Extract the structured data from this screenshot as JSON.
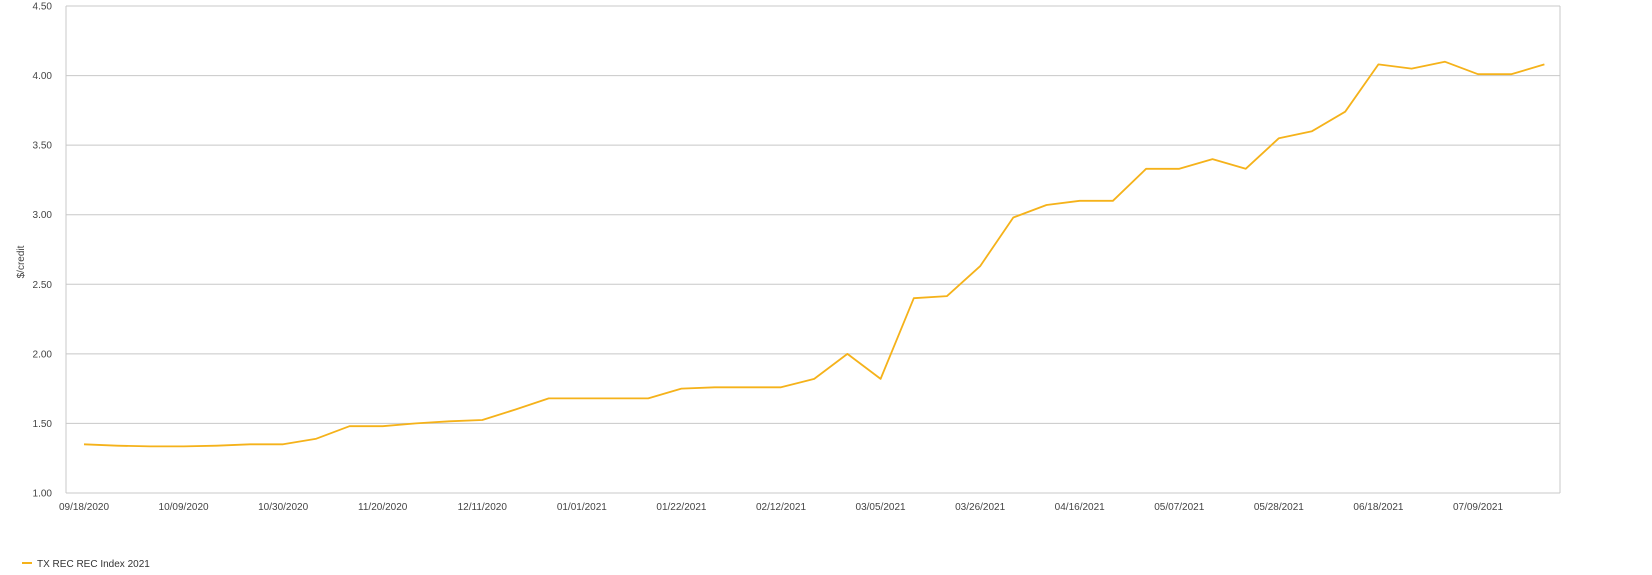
{
  "chart_data": {
    "type": "line",
    "title": "",
    "xlabel": "",
    "ylabel": "$/credit",
    "ylim": [
      1.0,
      4.5
    ],
    "yticks": [
      "1.00",
      "1.50",
      "2.00",
      "2.50",
      "3.00",
      "3.50",
      "4.00",
      "4.50"
    ],
    "xticks": [
      "09/18/2020",
      "10/09/2020",
      "10/30/2020",
      "11/20/2020",
      "12/11/2020",
      "01/01/2021",
      "01/22/2021",
      "02/12/2021",
      "03/05/2021",
      "03/26/2021",
      "04/16/2021",
      "05/07/2021",
      "05/28/2021",
      "06/18/2021",
      "07/09/2021"
    ],
    "grid": true,
    "legend_position": "bottom-left",
    "series": [
      {
        "name": "TX REC REC Index 2021",
        "color": "#F5B21A",
        "x": [
          "09/18/2020",
          "09/25/2020",
          "10/02/2020",
          "10/09/2020",
          "10/16/2020",
          "10/23/2020",
          "10/30/2020",
          "11/06/2020",
          "11/13/2020",
          "11/20/2020",
          "11/27/2020",
          "12/04/2020",
          "12/11/2020",
          "12/18/2020",
          "12/25/2020",
          "01/01/2021",
          "01/08/2021",
          "01/15/2021",
          "01/22/2021",
          "01/29/2021",
          "02/05/2021",
          "02/12/2021",
          "02/19/2021",
          "02/26/2021",
          "03/05/2021",
          "03/12/2021",
          "03/19/2021",
          "03/26/2021",
          "04/02/2021",
          "04/09/2021",
          "04/16/2021",
          "04/23/2021",
          "04/30/2021",
          "05/07/2021",
          "05/14/2021",
          "05/21/2021",
          "05/28/2021",
          "06/04/2021",
          "06/11/2021",
          "06/18/2021",
          "06/25/2021",
          "07/02/2021",
          "07/09/2021",
          "07/16/2021",
          "07/23/2021"
        ],
        "values": [
          1.35,
          1.34,
          1.335,
          1.335,
          1.34,
          1.35,
          1.35,
          1.39,
          1.48,
          1.48,
          1.5,
          1.515,
          1.525,
          1.6,
          1.68,
          1.68,
          1.68,
          1.68,
          1.75,
          1.76,
          1.76,
          1.76,
          1.82,
          2.0,
          1.82,
          2.4,
          2.415,
          2.63,
          2.98,
          3.07,
          3.1,
          3.1,
          3.33,
          3.33,
          3.4,
          3.33,
          3.55,
          3.6,
          3.74,
          4.08,
          4.05,
          4.1,
          4.01,
          4.01,
          4.08
        ]
      }
    ]
  }
}
